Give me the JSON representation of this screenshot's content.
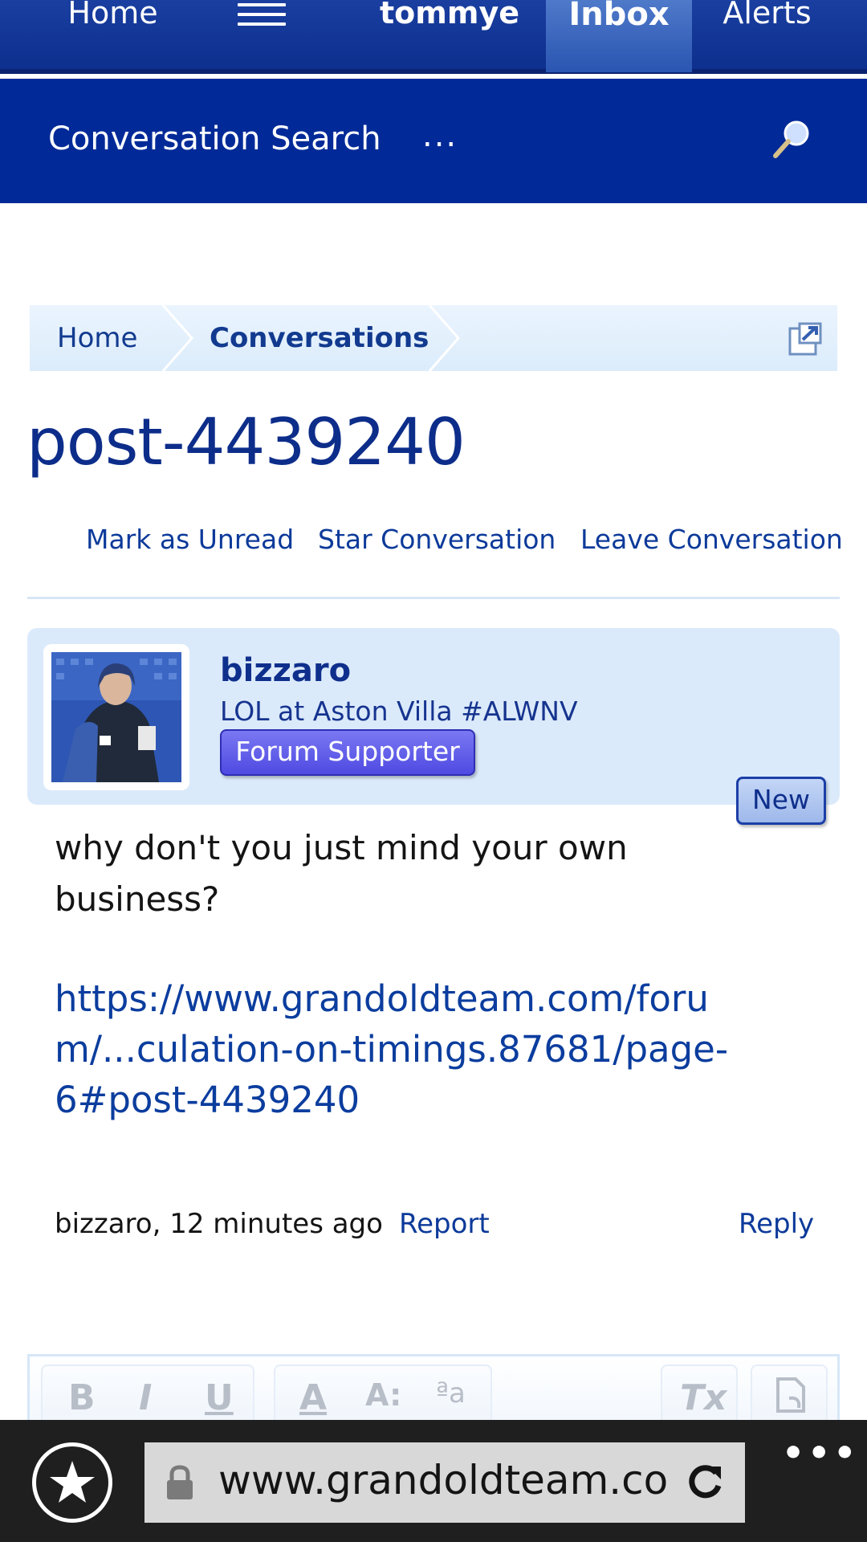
{
  "topnav": {
    "home_label": "Home",
    "user_label": "tommye",
    "inbox_label": "Inbox",
    "alerts_label": "Alerts"
  },
  "subbar": {
    "search_label": "Conversation Search",
    "more_label": "..."
  },
  "breadcrumb": {
    "items": [
      "Home",
      "Conversations"
    ]
  },
  "page": {
    "title": "post-4439240"
  },
  "actions": {
    "mark_unread": "Mark as Unread",
    "star": "Star Conversation",
    "leave": "Leave Conversation"
  },
  "message": {
    "username": "bizzaro",
    "user_title": "LOL at Aston Villa #ALWNV",
    "badge": "Forum Supporter",
    "new_label": "New",
    "body_text": "why don't you just mind your own business?",
    "link_text": "https://www.grandoldteam.com/forum/...culation-on-timings.87681/page-6#post-4439240",
    "meta": "bizzaro, 12 minutes ago",
    "report_label": "Report",
    "reply_label": "Reply"
  },
  "editor": {
    "tools": [
      "B",
      "I",
      "U",
      "A",
      "A:",
      "ªa",
      "Tx"
    ]
  },
  "browser": {
    "url": "www.grandoldteam.com/",
    "colors": {
      "bar": "#1f1f1f",
      "url_field": "#d8d8d8"
    }
  },
  "theme": {
    "nav_blue": "#0d2f8e",
    "subbar_blue": "#012a98",
    "link_blue": "#0c3a9a",
    "supporter_badge": "#5a55e8"
  }
}
